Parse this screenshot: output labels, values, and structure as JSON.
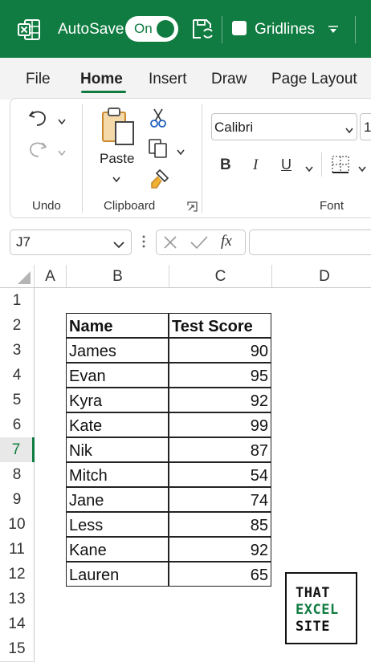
{
  "titlebar": {
    "autosave_label": "AutoSave",
    "autosave_state": "On",
    "gridlines_label": "Gridlines",
    "brand_color": "#107c41"
  },
  "menu": {
    "items": [
      "File",
      "Home",
      "Insert",
      "Draw",
      "Page Layout"
    ],
    "active": "Home"
  },
  "ribbon": {
    "groups": [
      "Undo",
      "Clipboard",
      "Font"
    ],
    "paste_label": "Paste",
    "font_name": "Calibri",
    "font_size_partial": "1",
    "bold_label": "B",
    "italic_label": "I",
    "underline_label": "U"
  },
  "formula_bar": {
    "name_box": "J7",
    "fx_label": "fx",
    "content": ""
  },
  "grid": {
    "columns": [
      "A",
      "B",
      "C",
      "D"
    ],
    "rows": [
      "1",
      "2",
      "3",
      "4",
      "5",
      "6",
      "7",
      "8",
      "9",
      "10",
      "11",
      "12",
      "13",
      "14",
      "15"
    ],
    "selected_row": "7",
    "table_headers": [
      "Name",
      "Test Score"
    ],
    "table_rows": [
      {
        "name": "James",
        "score": "90"
      },
      {
        "name": "Evan",
        "score": "95"
      },
      {
        "name": "Kyra",
        "score": "92"
      },
      {
        "name": "Kate",
        "score": "99"
      },
      {
        "name": "Nik",
        "score": "87"
      },
      {
        "name": "Mitch",
        "score": "54"
      },
      {
        "name": "Jane",
        "score": "74"
      },
      {
        "name": "Less",
        "score": "85"
      },
      {
        "name": "Kane",
        "score": "92"
      },
      {
        "name": "Lauren",
        "score": "65"
      }
    ]
  },
  "logo": {
    "line1": "THAT",
    "line2": "EXCEL",
    "line3": "SITE"
  }
}
